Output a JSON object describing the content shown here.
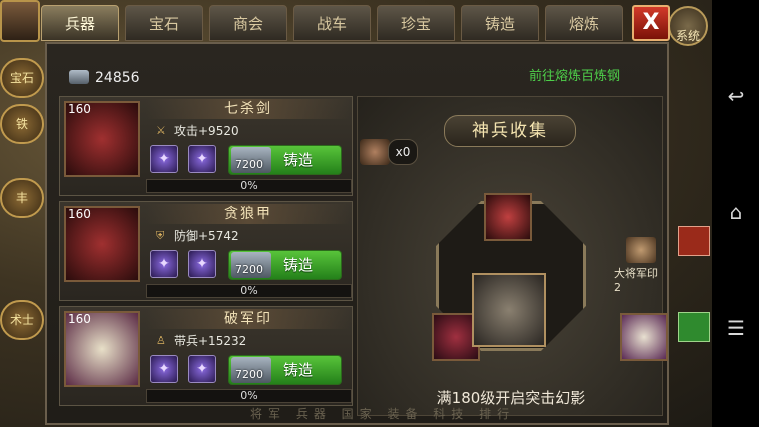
{
  "tabs": [
    {
      "label": "兵器",
      "active": true
    },
    {
      "label": "宝石",
      "active": false
    },
    {
      "label": "商会",
      "active": false
    },
    {
      "label": "战车",
      "active": false
    },
    {
      "label": "珍宝",
      "active": false
    },
    {
      "label": "铸造",
      "active": false
    },
    {
      "label": "熔炼",
      "active": false
    }
  ],
  "close_label": "X",
  "hud": {
    "left_buttons": [
      "宝石",
      "铁",
      "丰",
      "术士"
    ],
    "gear_label": "系统"
  },
  "resource": {
    "icon": "steel-ingot-icon",
    "amount": "24856"
  },
  "smelt_link": "前往熔炼百炼钢",
  "weapons": [
    {
      "level": "160",
      "name": "七杀剑",
      "stat_icon": "sword-icon",
      "stat": "攻击+9520",
      "gems": [
        "✦",
        "✦"
      ],
      "cost": "7200",
      "forge_label": "铸造",
      "progress": 0,
      "progress_text": "0%"
    },
    {
      "level": "160",
      "name": "贪狼甲",
      "stat_icon": "shield-icon",
      "stat": "防御+5742",
      "gems": [
        "✦",
        "✦"
      ],
      "cost": "7200",
      "forge_label": "铸造",
      "progress": 0,
      "progress_text": "0%"
    },
    {
      "level": "160",
      "name": "破军印",
      "stat_icon": "soldier-icon",
      "stat": "带兵+15232",
      "gems": [
        "✦",
        "✦"
      ],
      "cost": "7200",
      "forge_label": "铸造",
      "progress": 0,
      "progress_text": "0%"
    }
  ],
  "collection": {
    "title": "神兵收集",
    "hammer_count": "x0",
    "seal_label": "大将军印",
    "seal_count": "2",
    "unlock_text": "满180级开启突击幻影"
  },
  "footer_hint": "将军 兵器 国家 装备 科技 排行",
  "colors": {
    "accent_green": "#4ed04a",
    "close_red": "#d23a2a",
    "gold": "#c0a060"
  }
}
